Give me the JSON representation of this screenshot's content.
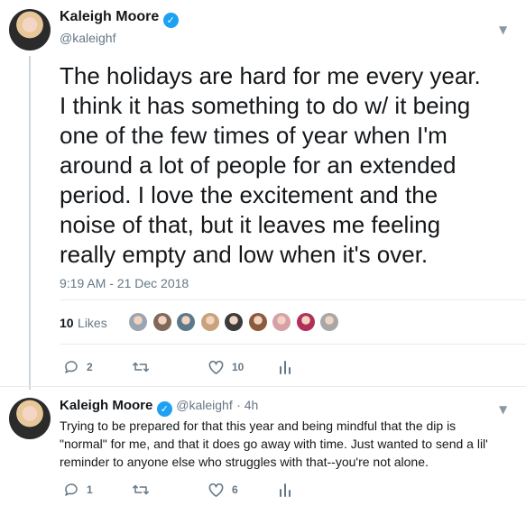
{
  "main_tweet": {
    "display_name": "Kaleigh Moore",
    "handle": "@kaleighf",
    "text_lines": [
      "The holidays are hard for me every year.",
      "I think it has something to do w/ it being",
      "one of the few times of year when I'm",
      "around a lot of people for an extended",
      "period. I love the excitement and the",
      "noise of that, but it leaves me feeling",
      "really empty and low when it's over."
    ],
    "timestamp": "9:19 AM - 21 Dec 2018",
    "likes_count": "10",
    "likes_label": "Likes",
    "liker_colors": [
      "#9aa5b1",
      "#7f6a5a",
      "#5a7a8c",
      "#c9a27c",
      "#3b3b3b",
      "#8c5a3c",
      "#d6a0a8",
      "#b0305a",
      "#a7a7a7"
    ],
    "actions": {
      "replies": "2",
      "retweets": "",
      "likes": "10"
    }
  },
  "reply_tweet": {
    "display_name": "Kaleigh Moore",
    "handle": "@kaleighf",
    "time": "· 4h",
    "text_lines": [
      "Trying to be prepared for that this year and being mindful that the dip is",
      "\"normal\" for me, and that it does go away with time. Just wanted to send a lil'",
      "reminder to anyone else who struggles with that--you're not alone."
    ],
    "actions": {
      "replies": "1",
      "retweets": "",
      "likes": "6"
    }
  },
  "colors": {
    "accent": "#1da1f2",
    "muted": "#657786",
    "text": "#14171a",
    "divider": "#e6ecf0"
  }
}
